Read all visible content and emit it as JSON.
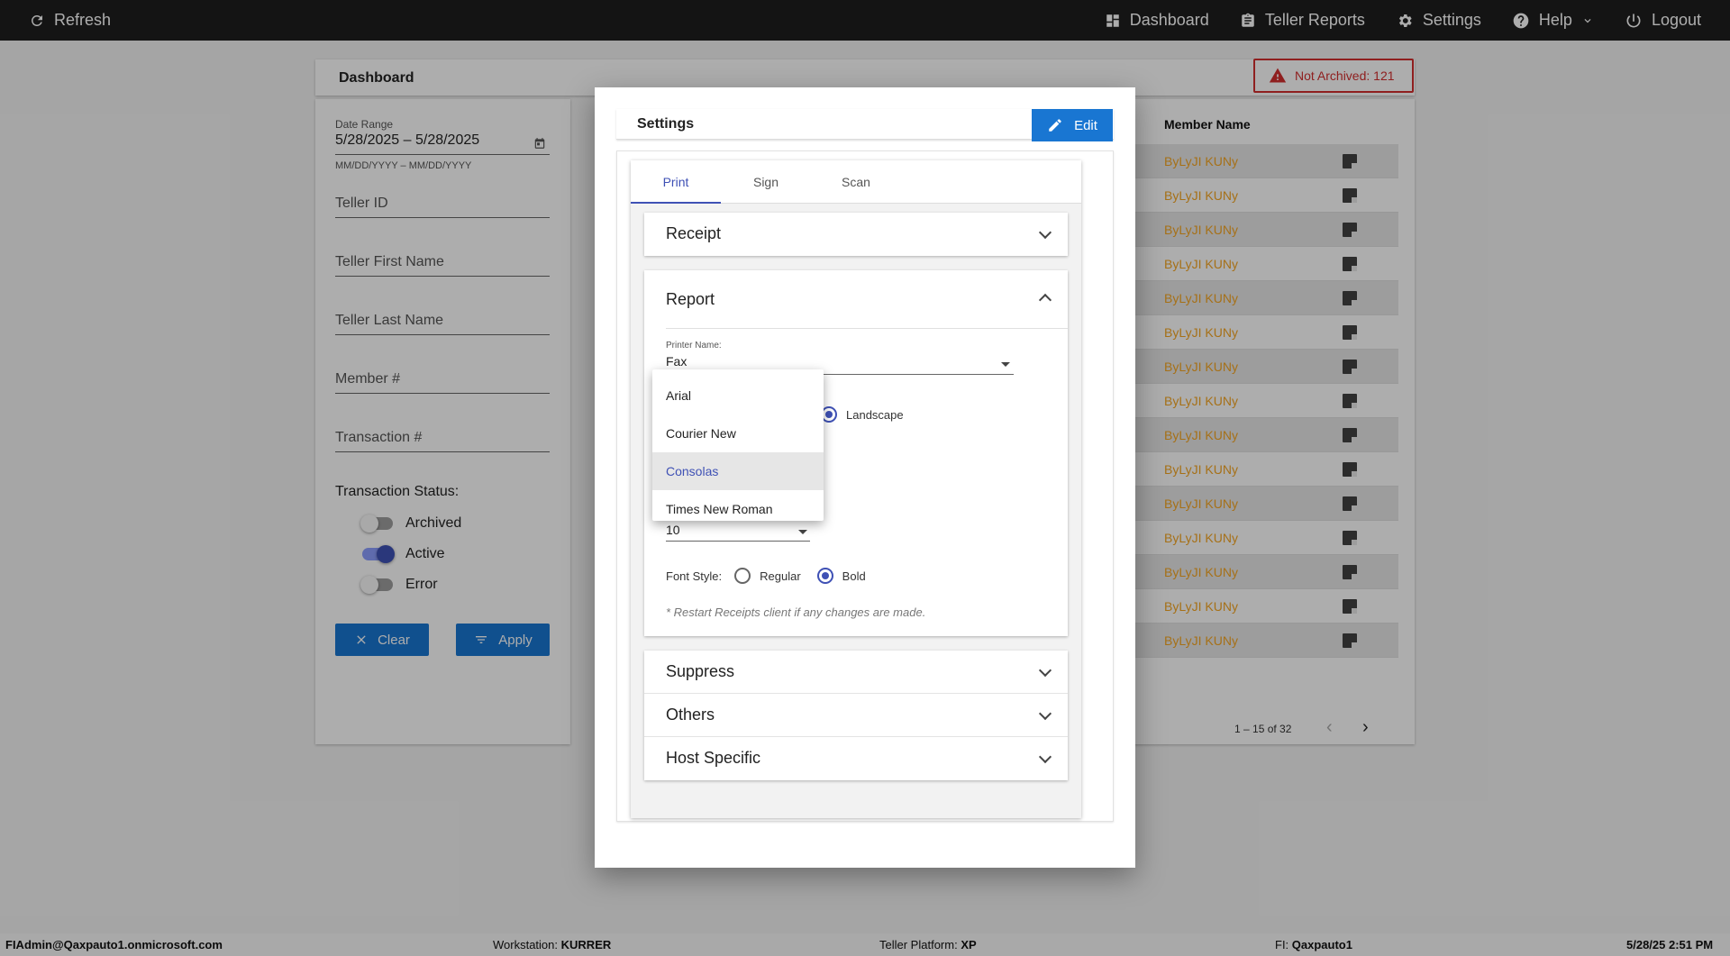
{
  "topbar": {
    "refresh_label": "Refresh",
    "nav": {
      "dashboard": "Dashboard",
      "teller_reports": "Teller Reports",
      "settings": "Settings",
      "help": "Help",
      "logout": "Logout"
    }
  },
  "dashboard": {
    "title": "Dashboard",
    "alert": "Not Archived: 121",
    "filters": {
      "date_range_label": "Date Range",
      "date_range_value": "5/28/2025 – 5/28/2025",
      "date_range_hint": "MM/DD/YYYY – MM/DD/YYYY",
      "teller_id": "Teller ID",
      "teller_first_name": "Teller First Name",
      "teller_last_name": "Teller Last Name",
      "member_number": "Member #",
      "transaction_number": "Transaction #",
      "status_label": "Transaction Status:",
      "toggles": [
        {
          "label": "Archived",
          "on": false
        },
        {
          "label": "Active",
          "on": true
        },
        {
          "label": "Error",
          "on": false
        }
      ],
      "clear_label": "Clear",
      "apply_label": "Apply"
    },
    "table": {
      "header": "Member Name",
      "rows": [
        "ByLyJI KUNy",
        "ByLyJI KUNy",
        "ByLyJI KUNy",
        "ByLyJI KUNy",
        "ByLyJI KUNy",
        "ByLyJI KUNy",
        "ByLyJI KUNy",
        "ByLyJI KUNy",
        "ByLyJI KUNy",
        "ByLyJI KUNy",
        "ByLyJI KUNy",
        "ByLyJI KUNy",
        "ByLyJI KUNy",
        "ByLyJI KUNy",
        "ByLyJI KUNy"
      ],
      "pager": "1 – 15 of 32"
    }
  },
  "modal": {
    "title": "Settings",
    "edit_label": "Edit",
    "tabs": [
      "Print",
      "Sign",
      "Scan"
    ],
    "active_tab": "Print",
    "panels": {
      "receipt": "Receipt",
      "report": "Report",
      "suppress": "Suppress",
      "others": "Others",
      "host_specific": "Host Specific"
    },
    "report": {
      "printer_label": "Printer Name:",
      "printer_value": "Fax",
      "orientation_option": "Landscape",
      "font_size_value": "10",
      "font_style_label": "Font Style:",
      "font_style_options": [
        "Regular",
        "Bold"
      ],
      "font_style_selected": "Bold",
      "restart_note": "* Restart Receipts client if any changes are made."
    },
    "font_menu": {
      "options": [
        "Arial",
        "Courier New",
        "Consolas",
        "Times New Roman"
      ],
      "highlighted": "Consolas"
    }
  },
  "statusbar": {
    "user": "FIAdmin@Qaxpauto1.onmicrosoft.com",
    "workstation_label": "Workstation:",
    "workstation": "KURRER",
    "platform_label": "Teller Platform:",
    "platform": "XP",
    "fi_label": "FI:",
    "fi": "Qaxpauto1",
    "datetime": "5/28/25 2:51 PM"
  },
  "colors": {
    "accent": "#3f51b5",
    "primary_button": "#1976d2",
    "alert": "#d32f2f",
    "member_name": "#f5a623"
  }
}
